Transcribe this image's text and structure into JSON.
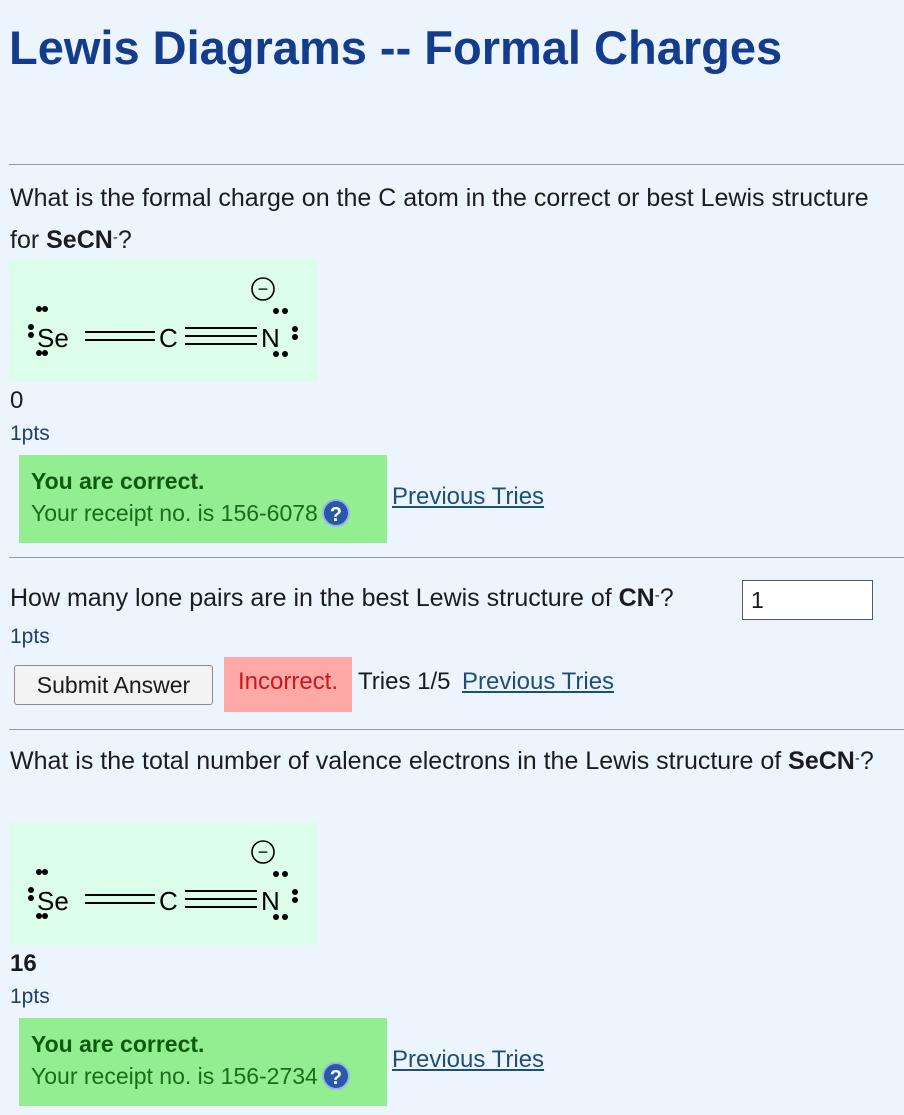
{
  "page_title": "Lewis Diagrams -- Formal Charges",
  "questions": [
    {
      "text_before": "What is the formal charge on the C atom in the correct or best Lewis structure for ",
      "formula": "SeCN",
      "charge": "-",
      "text_after": "?",
      "structure": {
        "left_atom": "Se",
        "middle_atom": "C",
        "right_atom": "N",
        "charge_symbol": "−"
      },
      "answer": "0",
      "points": "1pts",
      "feedback": {
        "heading": "You are correct.",
        "receipt_label": "Your receipt no. is 156-6078",
        "help_icon": "question-mark-icon"
      },
      "previous_tries_label": "Previous Tries"
    },
    {
      "text_before": "How many lone pairs are in the best Lewis structure of ",
      "formula": "CN",
      "charge": "-",
      "text_after": "?",
      "input_value": "1",
      "points": "1pts",
      "submit_label": "Submit Answer",
      "status_label": "Incorrect.",
      "tries_label": "Tries 1/5",
      "previous_tries_label": "Previous Tries"
    },
    {
      "text_before": "What is the total number of valence electrons in the Lewis structure of ",
      "formula": "SeCN",
      "charge": "-",
      "text_after": "?",
      "structure": {
        "left_atom": "Se",
        "middle_atom": "C",
        "right_atom": "N",
        "charge_symbol": "−"
      },
      "answer": "16",
      "points": "1pts",
      "feedback": {
        "heading": "You are correct.",
        "receipt_label": "Your receipt no. is 156-2734",
        "help_icon": "question-mark-icon"
      },
      "previous_tries_label": "Previous Tries"
    }
  ],
  "colors": {
    "background": "#ecf4fe",
    "title": "#143c8c",
    "correct_bg": "#92ee90",
    "incorrect_bg": "#ffa8a8",
    "structure_bg": "#dcfde9"
  }
}
